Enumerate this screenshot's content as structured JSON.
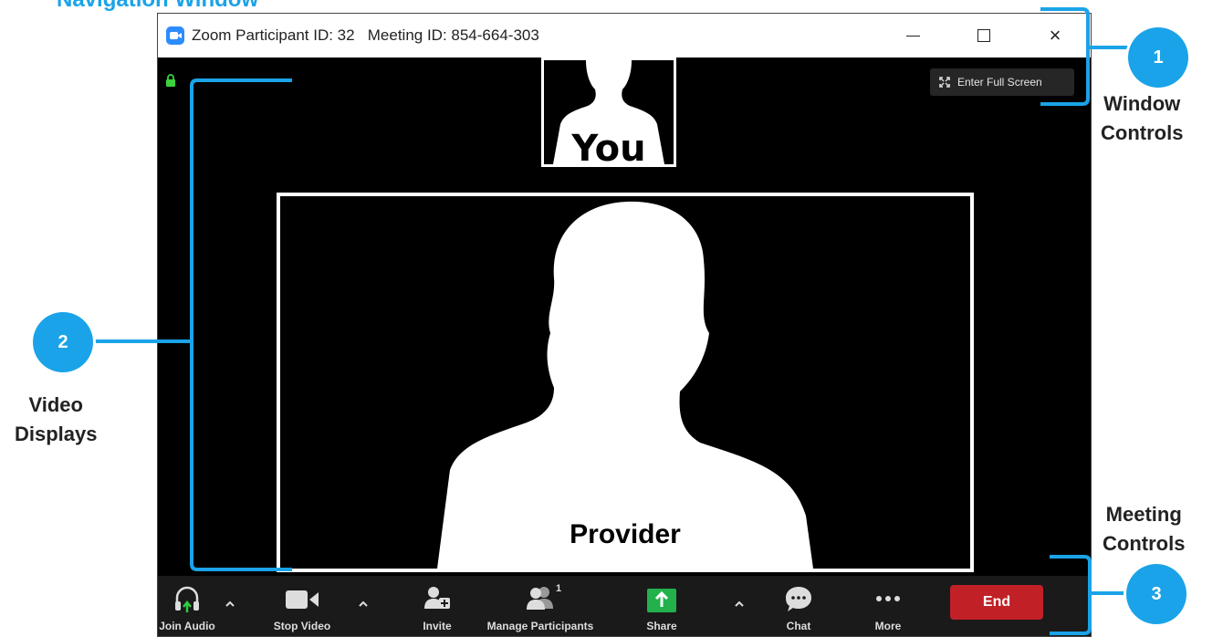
{
  "page_heading": "Navigation Window",
  "window": {
    "title": "Zoom Participant ID: 32   Meeting ID: 854-664-303",
    "controls": {
      "minimize": "minimize-icon",
      "maximize": "maximize-icon",
      "close": "×"
    },
    "fullscreen_label": "Enter Full Screen"
  },
  "video": {
    "self_label": "You",
    "provider_label": "Provider"
  },
  "toolbar": {
    "join_audio": "Join Audio",
    "stop_video": "Stop Video",
    "invite": "Invite",
    "manage_participants": "Manage Participants",
    "participant_count": "1",
    "share": "Share",
    "chat": "Chat",
    "more": "More",
    "end": "End"
  },
  "callouts": [
    {
      "number": "1",
      "label_line1": "Window",
      "label_line2": "Controls"
    },
    {
      "number": "2",
      "label_line1": "Video",
      "label_line2": "Displays"
    },
    {
      "number": "3",
      "label_line1": "Meeting",
      "label_line2": "Controls"
    }
  ],
  "colors": {
    "accent": "#1aa3e8",
    "end_button": "#c12126",
    "share_icon": "#22b14c",
    "audio_arrow": "#2ecc40"
  }
}
